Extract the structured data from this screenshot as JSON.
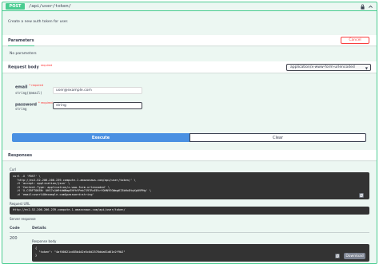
{
  "operation": {
    "method": "POST",
    "path": "/api/user/token/",
    "description": "Create a new auth token for user."
  },
  "parameters": {
    "title": "Parameters",
    "cancel_label": "Cancel",
    "empty_text": "No parameters"
  },
  "request_body": {
    "title": "Request body",
    "required_mark": "required",
    "content_type": "application/x-www-form-urlencoded",
    "fields": [
      {
        "name": "email",
        "required_mark": "* required",
        "type": "string($email)",
        "value": "user@example.com"
      },
      {
        "name": "password",
        "required_mark": "* required",
        "type": "string",
        "value": "string"
      }
    ]
  },
  "actions": {
    "execute_label": "Execute",
    "clear_label": "Clear"
  },
  "responses": {
    "title": "Responses",
    "curl_label": "Curl",
    "curl_lines": [
      "curl -X 'POST' \\",
      "  'http://ec2-52-206-206-239.compute-1.amazonaws.com/api/user/token/' \\",
      "  -H 'accept: application/json' \\",
      "  -H 'Content-Type: application/x-www-form-urlencoded' \\",
      "  -H 'X-CSRFTOKEN: UKS7x1W9tbWNmpEHfhYPeb7J97RcEEtrYOHNYEGWmg6I3bHxDtqXp0VPHg' \\",
      "  -d 'email=user%40example.com&password=string'"
    ],
    "request_url_label": "Request URL",
    "request_url": "http://ec2-52-206-206-239.compute-1.amazonaws.com/api/user/token/",
    "server_response_label": "Server response",
    "code_header": "Code",
    "details_header": "Details",
    "status_code": "200",
    "body_label": "Response body",
    "body_lines": [
      "{",
      "  \"token\": \"4af00021cd85b4d2e5c0d2576dda61d61e2f9b2\"",
      "}"
    ],
    "download_label": "Download"
  },
  "colors": {
    "post_green": "#49cc90",
    "execute_blue": "#4990e2",
    "cancel_red": "#f93e3e",
    "code_bg": "#333333"
  },
  "icons": [
    "lock-icon",
    "chevron-up-icon",
    "copy-icon",
    "dropdown-arrow-icon"
  ]
}
